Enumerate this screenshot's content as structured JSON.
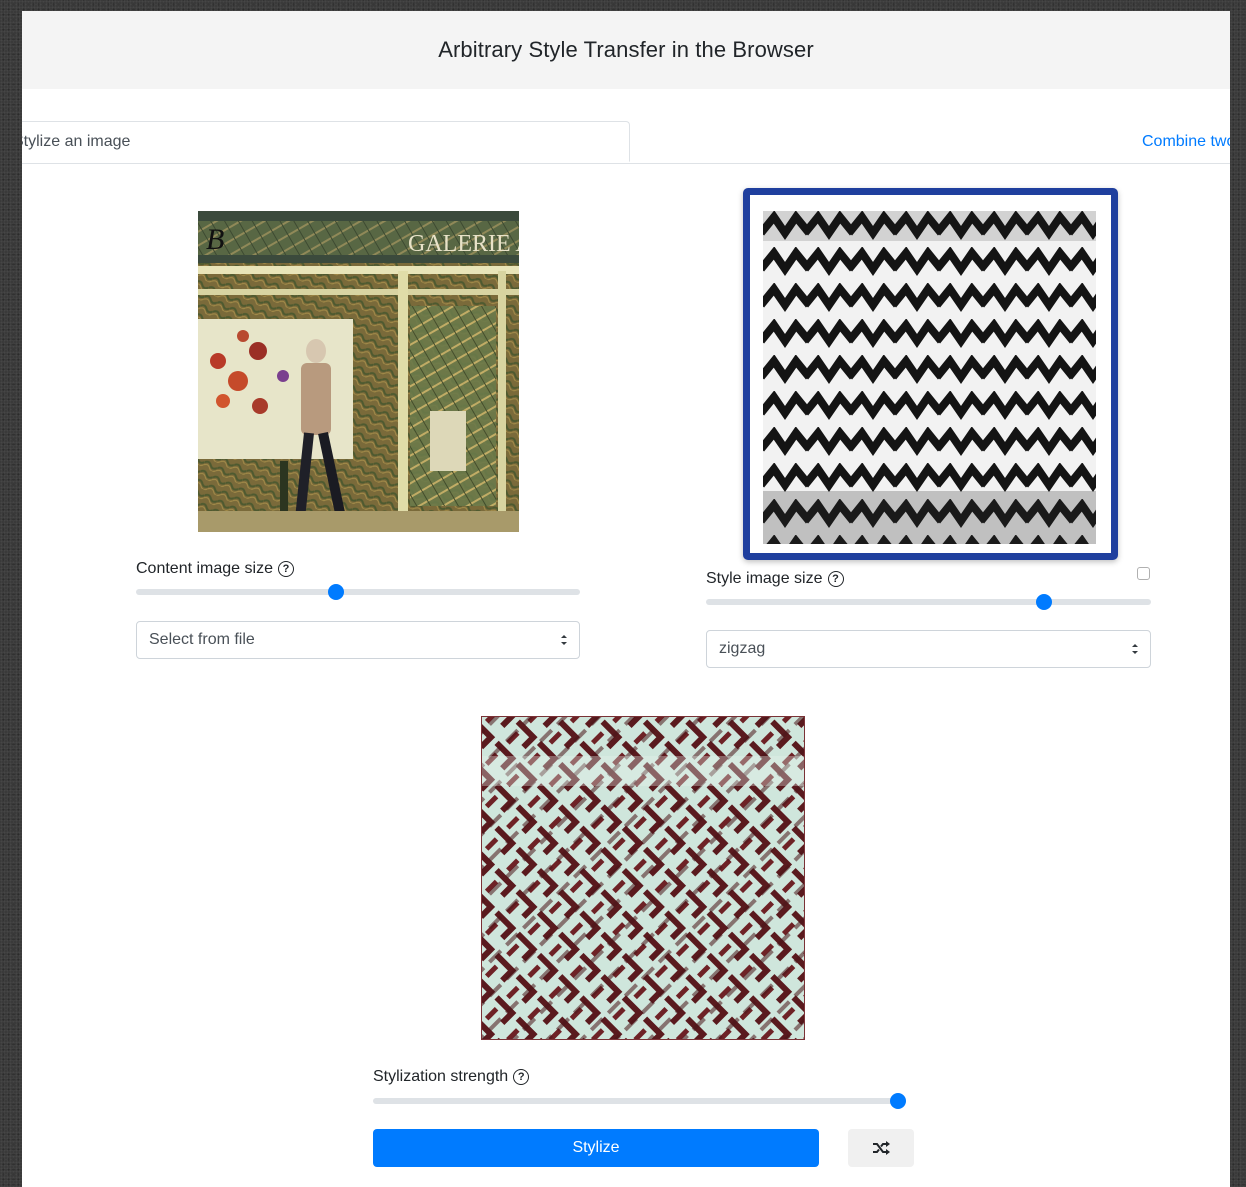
{
  "header": {
    "title": "Arbitrary Style Transfer in the Browser"
  },
  "tabs": [
    {
      "label": "Stylize an image",
      "active": true
    },
    {
      "label": "Combine two styles",
      "active": false
    }
  ],
  "content": {
    "size_label": "Content image size",
    "size_value": 0.45,
    "select_value": "Select from file",
    "image_icon": "content-photo"
  },
  "style": {
    "size_label": "Style image size",
    "size_value": 0.76,
    "select_value": "zigzag",
    "image_icon": "zigzag-pattern",
    "square_checked": false
  },
  "stylization": {
    "strength_label": "Stylization strength",
    "strength_value": 1.0,
    "stylize_button": "Stylize",
    "random_icon": "shuffle-icon"
  },
  "colors": {
    "accent": "#007bff",
    "style_frame": "#1f3f9e"
  }
}
